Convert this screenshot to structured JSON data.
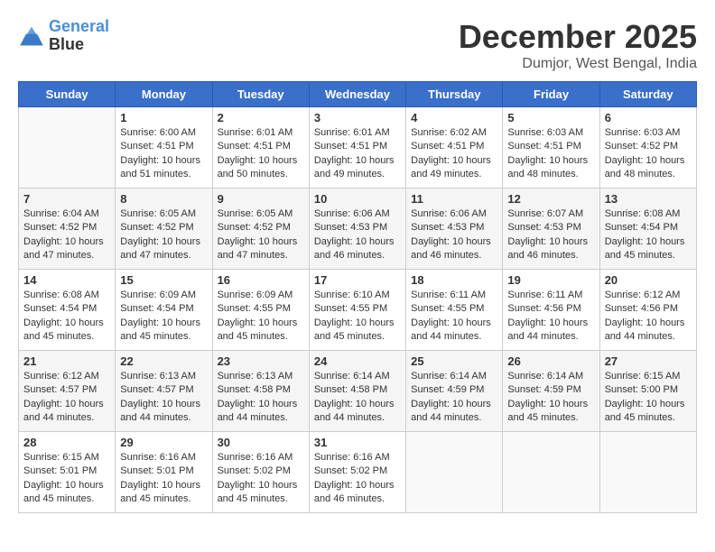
{
  "header": {
    "logo_line1": "General",
    "logo_line2": "Blue",
    "month": "December 2025",
    "location": "Dumjor, West Bengal, India"
  },
  "days_of_week": [
    "Sunday",
    "Monday",
    "Tuesday",
    "Wednesday",
    "Thursday",
    "Friday",
    "Saturday"
  ],
  "weeks": [
    [
      {
        "day": "",
        "info": ""
      },
      {
        "day": "1",
        "info": "Sunrise: 6:00 AM\nSunset: 4:51 PM\nDaylight: 10 hours\nand 51 minutes."
      },
      {
        "day": "2",
        "info": "Sunrise: 6:01 AM\nSunset: 4:51 PM\nDaylight: 10 hours\nand 50 minutes."
      },
      {
        "day": "3",
        "info": "Sunrise: 6:01 AM\nSunset: 4:51 PM\nDaylight: 10 hours\nand 49 minutes."
      },
      {
        "day": "4",
        "info": "Sunrise: 6:02 AM\nSunset: 4:51 PM\nDaylight: 10 hours\nand 49 minutes."
      },
      {
        "day": "5",
        "info": "Sunrise: 6:03 AM\nSunset: 4:51 PM\nDaylight: 10 hours\nand 48 minutes."
      },
      {
        "day": "6",
        "info": "Sunrise: 6:03 AM\nSunset: 4:52 PM\nDaylight: 10 hours\nand 48 minutes."
      }
    ],
    [
      {
        "day": "7",
        "info": "Sunrise: 6:04 AM\nSunset: 4:52 PM\nDaylight: 10 hours\nand 47 minutes."
      },
      {
        "day": "8",
        "info": "Sunrise: 6:05 AM\nSunset: 4:52 PM\nDaylight: 10 hours\nand 47 minutes."
      },
      {
        "day": "9",
        "info": "Sunrise: 6:05 AM\nSunset: 4:52 PM\nDaylight: 10 hours\nand 47 minutes."
      },
      {
        "day": "10",
        "info": "Sunrise: 6:06 AM\nSunset: 4:53 PM\nDaylight: 10 hours\nand 46 minutes."
      },
      {
        "day": "11",
        "info": "Sunrise: 6:06 AM\nSunset: 4:53 PM\nDaylight: 10 hours\nand 46 minutes."
      },
      {
        "day": "12",
        "info": "Sunrise: 6:07 AM\nSunset: 4:53 PM\nDaylight: 10 hours\nand 46 minutes."
      },
      {
        "day": "13",
        "info": "Sunrise: 6:08 AM\nSunset: 4:54 PM\nDaylight: 10 hours\nand 45 minutes."
      }
    ],
    [
      {
        "day": "14",
        "info": "Sunrise: 6:08 AM\nSunset: 4:54 PM\nDaylight: 10 hours\nand 45 minutes."
      },
      {
        "day": "15",
        "info": "Sunrise: 6:09 AM\nSunset: 4:54 PM\nDaylight: 10 hours\nand 45 minutes."
      },
      {
        "day": "16",
        "info": "Sunrise: 6:09 AM\nSunset: 4:55 PM\nDaylight: 10 hours\nand 45 minutes."
      },
      {
        "day": "17",
        "info": "Sunrise: 6:10 AM\nSunset: 4:55 PM\nDaylight: 10 hours\nand 45 minutes."
      },
      {
        "day": "18",
        "info": "Sunrise: 6:11 AM\nSunset: 4:55 PM\nDaylight: 10 hours\nand 44 minutes."
      },
      {
        "day": "19",
        "info": "Sunrise: 6:11 AM\nSunset: 4:56 PM\nDaylight: 10 hours\nand 44 minutes."
      },
      {
        "day": "20",
        "info": "Sunrise: 6:12 AM\nSunset: 4:56 PM\nDaylight: 10 hours\nand 44 minutes."
      }
    ],
    [
      {
        "day": "21",
        "info": "Sunrise: 6:12 AM\nSunset: 4:57 PM\nDaylight: 10 hours\nand 44 minutes."
      },
      {
        "day": "22",
        "info": "Sunrise: 6:13 AM\nSunset: 4:57 PM\nDaylight: 10 hours\nand 44 minutes."
      },
      {
        "day": "23",
        "info": "Sunrise: 6:13 AM\nSunset: 4:58 PM\nDaylight: 10 hours\nand 44 minutes."
      },
      {
        "day": "24",
        "info": "Sunrise: 6:14 AM\nSunset: 4:58 PM\nDaylight: 10 hours\nand 44 minutes."
      },
      {
        "day": "25",
        "info": "Sunrise: 6:14 AM\nSunset: 4:59 PM\nDaylight: 10 hours\nand 44 minutes."
      },
      {
        "day": "26",
        "info": "Sunrise: 6:14 AM\nSunset: 4:59 PM\nDaylight: 10 hours\nand 45 minutes."
      },
      {
        "day": "27",
        "info": "Sunrise: 6:15 AM\nSunset: 5:00 PM\nDaylight: 10 hours\nand 45 minutes."
      }
    ],
    [
      {
        "day": "28",
        "info": "Sunrise: 6:15 AM\nSunset: 5:01 PM\nDaylight: 10 hours\nand 45 minutes."
      },
      {
        "day": "29",
        "info": "Sunrise: 6:16 AM\nSunset: 5:01 PM\nDaylight: 10 hours\nand 45 minutes."
      },
      {
        "day": "30",
        "info": "Sunrise: 6:16 AM\nSunset: 5:02 PM\nDaylight: 10 hours\nand 45 minutes."
      },
      {
        "day": "31",
        "info": "Sunrise: 6:16 AM\nSunset: 5:02 PM\nDaylight: 10 hours\nand 46 minutes."
      },
      {
        "day": "",
        "info": ""
      },
      {
        "day": "",
        "info": ""
      },
      {
        "day": "",
        "info": ""
      }
    ]
  ]
}
